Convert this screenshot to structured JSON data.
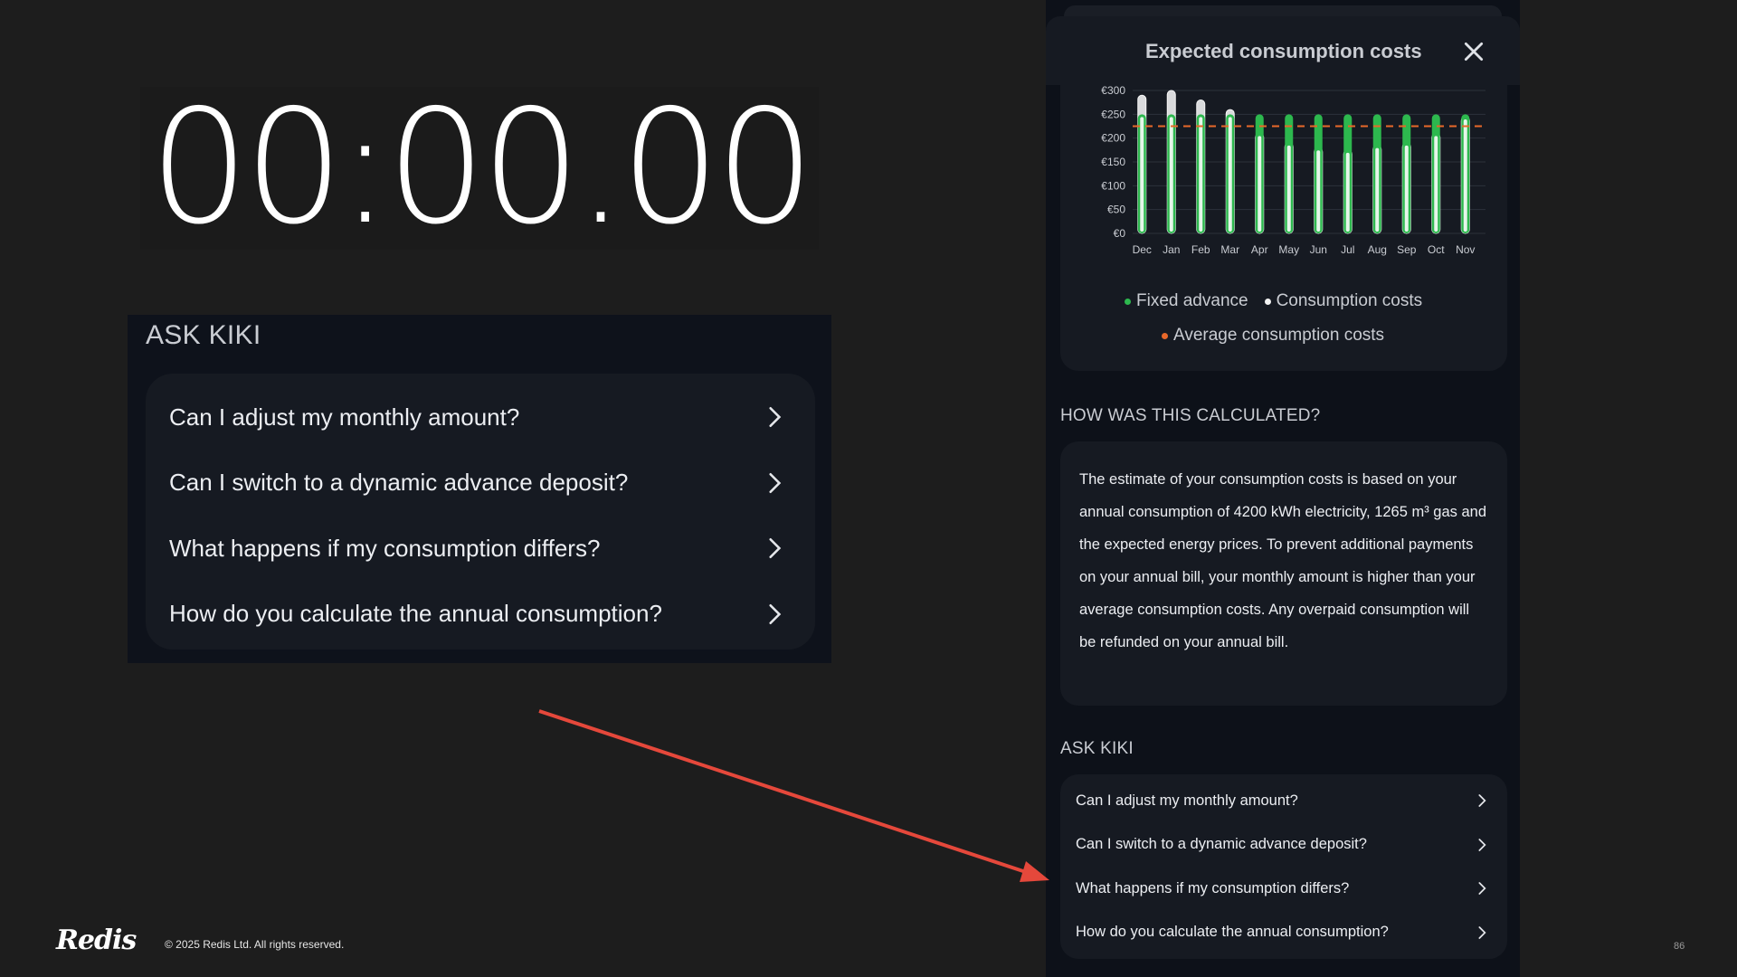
{
  "timer": {
    "value": "00:00.00"
  },
  "kiki_big": {
    "title": "ASK KIKI",
    "items": [
      "Can I adjust my monthly amount?",
      "Can I switch to a dynamic advance deposit?",
      "What happens if my consumption differs?",
      "How do you calculate the annual consumption?"
    ]
  },
  "phone": {
    "modal_title": "Expected consumption costs",
    "legend": {
      "fixed_advance": "Fixed advance",
      "consumption_costs": "Consumption costs",
      "average": "Average consumption costs"
    },
    "calc_title": "HOW WAS THIS CALCULATED?",
    "calc_text": "The estimate of your consumption costs is based on your annual consumption of 4200 kWh electricity, 1265 m³ gas and the expected energy prices. To prevent additional payments on your annual bill, your monthly amount is higher than your average consumption costs. Any overpaid consumption will be refunded on your annual bill.",
    "kiki_title": "ASK KIKI",
    "kiki_items": [
      "Can I adjust my monthly amount?",
      "Can I switch to a dynamic advance deposit?",
      "What happens if my consumption differs?",
      "How do you calculate the annual consumption?"
    ]
  },
  "chart_data": {
    "type": "bar",
    "categories": [
      "Dec",
      "Jan",
      "Feb",
      "Mar",
      "Apr",
      "May",
      "Jun",
      "Jul",
      "Aug",
      "Sep",
      "Oct",
      "Nov"
    ],
    "y_ticks": [
      "€0",
      "€50",
      "€100",
      "€150",
      "€200",
      "€250",
      "€300"
    ],
    "ylim": [
      0,
      300
    ],
    "series": [
      {
        "name": "Fixed advance",
        "values": [
          250,
          250,
          250,
          250,
          250,
          250,
          250,
          250,
          250,
          250,
          250,
          250
        ]
      },
      {
        "name": "Consumption costs",
        "values": [
          290,
          300,
          280,
          260,
          210,
          190,
          180,
          175,
          185,
          190,
          210,
          245
        ]
      },
      {
        "name": "Average consumption costs",
        "values": [
          225,
          225,
          225,
          225,
          225,
          225,
          225,
          225,
          225,
          225,
          225,
          225
        ]
      }
    ],
    "colors": {
      "fixed": "#2db84e",
      "consumption": "#e8e8e8",
      "average": "#e8682a",
      "grid": "#2c313b"
    },
    "legend": "bottom"
  },
  "footer": {
    "logo": "Redis",
    "copyright": "© 2025 Redis Ltd. All rights reserved.",
    "page": "86"
  },
  "colors": {
    "arrow": "#e5483b",
    "background": "#1d1d1d",
    "panel": "#0d1119",
    "card": "#161a22"
  }
}
